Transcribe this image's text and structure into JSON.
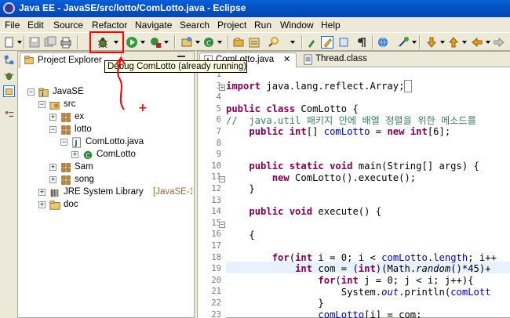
{
  "window": {
    "title": "Java EE - JavaSE/src/lotto/ComLotto.java - Eclipse"
  },
  "menu": [
    "File",
    "Edit",
    "Source",
    "Refactor",
    "Navigate",
    "Search",
    "Project",
    "Run",
    "Window",
    "Help"
  ],
  "tooltip": "Debug ComLotto (already running)",
  "explorer": {
    "tab_label": "Project Explorer",
    "tree": [
      {
        "label": "JavaSE",
        "expander": "−"
      },
      {
        "label": "src",
        "expander": "−"
      },
      {
        "label": "ex",
        "expander": "+"
      },
      {
        "label": "lotto",
        "expander": "−"
      },
      {
        "label": "ComLotto.java",
        "expander": "−"
      },
      {
        "label": "ComLotto",
        "expander": "+"
      },
      {
        "label": "Sam",
        "expander": "+"
      },
      {
        "label": "song",
        "expander": "+"
      },
      {
        "label": "JRE System Library",
        "decoration": "[JavaSE-1.",
        "expander": "+"
      },
      {
        "label": "doc",
        "expander": "+"
      }
    ]
  },
  "editor": {
    "tabs": [
      "ComLotto.java",
      "Thread.class"
    ],
    "line_numbers": [
      "1",
      "3",
      "4",
      "5",
      "6",
      "7",
      "8",
      "9",
      "10",
      "11",
      "12",
      "13",
      "14",
      "15",
      "16",
      "17",
      "18",
      "19",
      "20",
      "21",
      "22",
      "23",
      "24"
    ],
    "current_line": "20"
  },
  "annotation": {
    "plus_symbol": "+",
    "highlight_color": "#ff0000"
  },
  "colors": {
    "keyword": "#7f0055",
    "comment": "#3f7f5f",
    "field": "#0000c0",
    "title_bar": "#0553c4"
  }
}
